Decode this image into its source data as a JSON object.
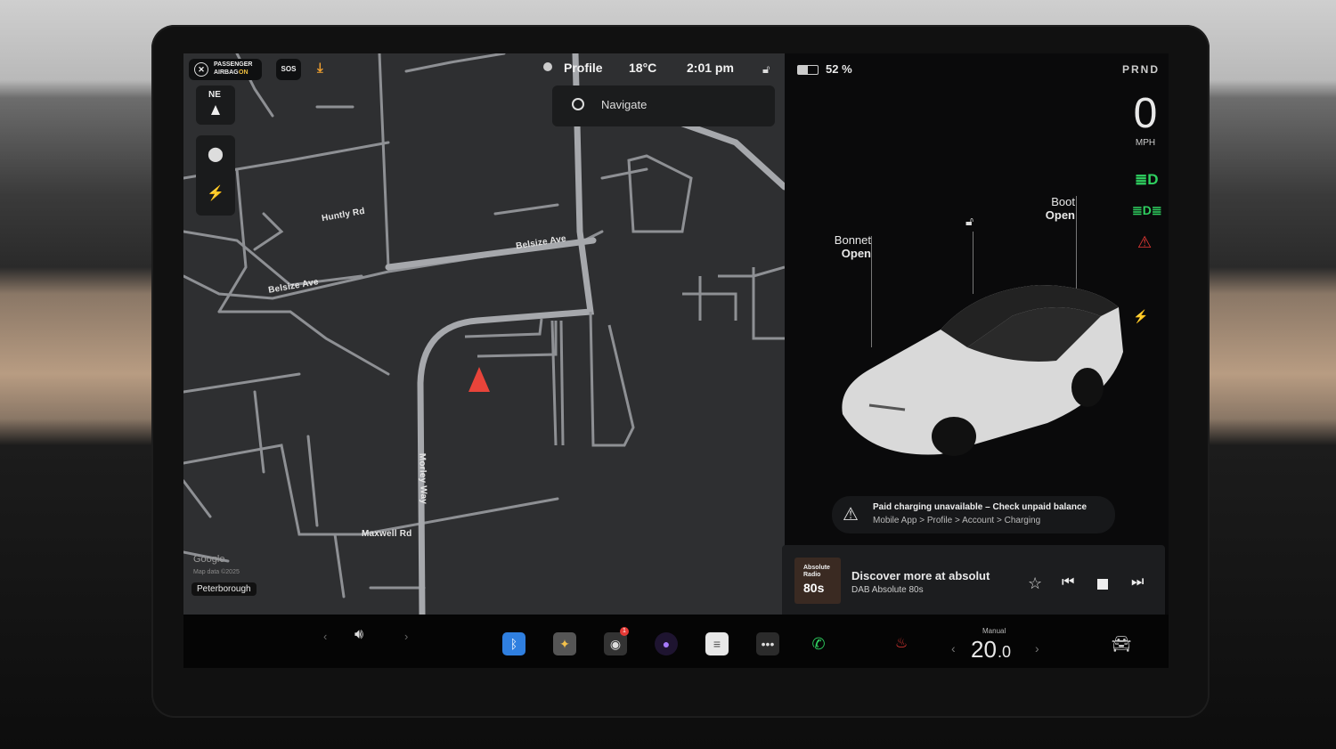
{
  "status": {
    "airbag_line1": "PASSENGER",
    "airbag_line2": "AIRBAG",
    "airbag_state": "ON",
    "sos": "SOS",
    "profile": "Profile",
    "temperature": "18°C",
    "time": "2:01 pm",
    "battery": "52 %",
    "gear": "PRND"
  },
  "map": {
    "compass": "NE",
    "search_placeholder": "Navigate",
    "roads": [
      "Huntly Rd",
      "Belsize Ave",
      "Belsize Ave",
      "Morley Way",
      "Maxwell Rd"
    ],
    "google": "Google",
    "map_data": "Map data ©2025",
    "city": "Peterborough"
  },
  "vehicle": {
    "speed": "0",
    "speed_unit": "MPH",
    "bonnet_label": "Bonnet",
    "bonnet_state": "Open",
    "boot_label": "Boot",
    "boot_state": "Open",
    "alert_title": "Paid charging unavailable – Check unpaid balance",
    "alert_path": "Mobile App > Profile > Account > Charging",
    "colors": {
      "headlight": "#2fd060",
      "seatbelt": "#e53935",
      "nav_arrow": "#e8443a"
    }
  },
  "media": {
    "art_line1": "Absolute",
    "art_line2": "Radio",
    "art_line3": "80s",
    "title": "Discover more at absolut",
    "station": "DAB Absolute 80s"
  },
  "dock": {
    "climate_mode": "Manual",
    "temp_whole": "20",
    "temp_decimal": ".0",
    "camera_badge": "1"
  }
}
